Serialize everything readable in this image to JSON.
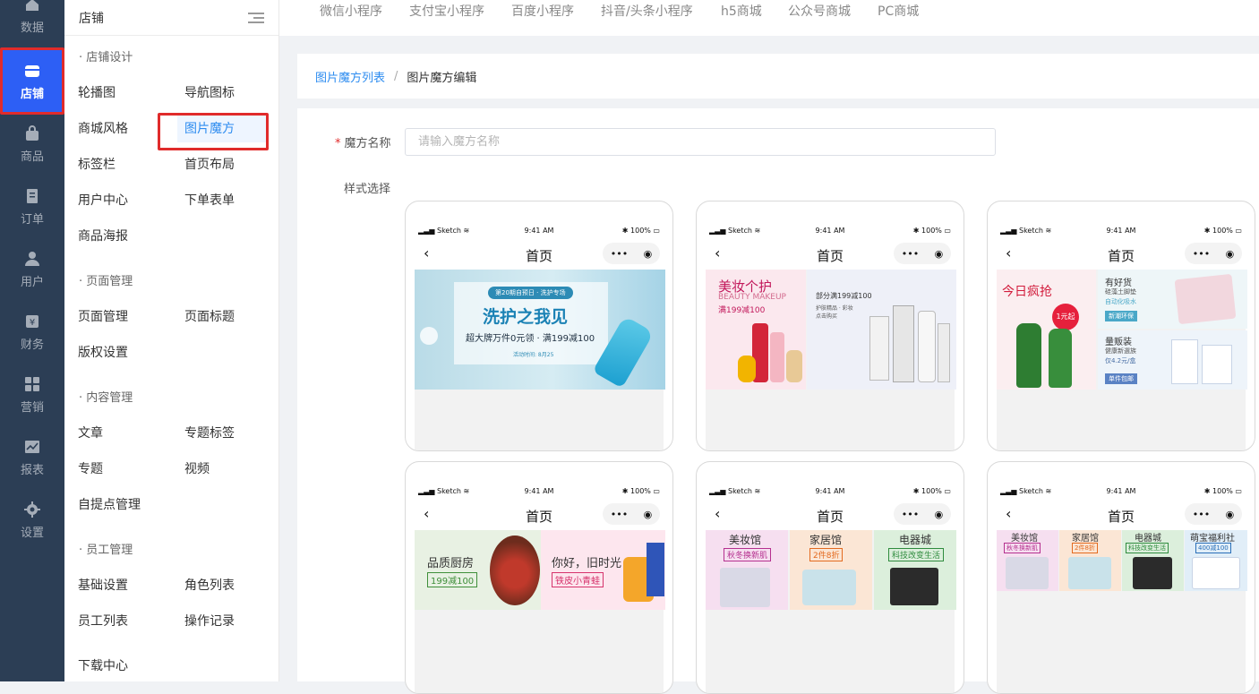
{
  "rail": [
    {
      "label": "数据",
      "icon": "home-icon"
    },
    {
      "label": "店铺",
      "icon": "store-icon",
      "active": true
    },
    {
      "label": "商品",
      "icon": "bag-icon"
    },
    {
      "label": "订单",
      "icon": "order-icon"
    },
    {
      "label": "用户",
      "icon": "user-icon"
    },
    {
      "label": "财务",
      "icon": "yen-icon"
    },
    {
      "label": "营销",
      "icon": "grid-icon"
    },
    {
      "label": "报表",
      "icon": "chart-icon"
    },
    {
      "label": "设置",
      "icon": "gear-icon"
    }
  ],
  "submenu": {
    "title": "店铺",
    "groups": {
      "design": "· 店铺设计",
      "page": "· 页面管理",
      "content": "· 内容管理",
      "staff": "· 员工管理"
    },
    "items": {
      "carousel": "轮播图",
      "nav_icon": "导航图标",
      "mall_style": "商城风格",
      "image_cube": "图片魔方",
      "tabbar": "标签栏",
      "home_layout": "首页布局",
      "user_center": "用户中心",
      "order_form": "下单表单",
      "poster": "商品海报",
      "page_manage": "页面管理",
      "page_title": "页面标题",
      "copyright": "版权设置",
      "article": "文章",
      "topic_tag": "专题标签",
      "topic": "专题",
      "video": "视频",
      "pickup": "自提点管理",
      "basic": "基础设置",
      "roles": "角色列表",
      "staff_list": "员工列表",
      "oplog": "操作记录",
      "download": "下载中心"
    }
  },
  "topbar": [
    "微信小程序",
    "支付宝小程序",
    "百度小程序",
    "抖音/头条小程序",
    "h5商城",
    "公众号商城",
    "PC商城"
  ],
  "breadcrumb": {
    "parent": "图片魔方列表",
    "sep": "/",
    "current": "图片魔方编辑"
  },
  "form": {
    "name_label": "魔方名称",
    "required_mark": "*",
    "name_placeholder": "请输入魔方名称",
    "name_value": "",
    "style_label": "样式选择"
  },
  "phone": {
    "carrier": "Sketch",
    "time": "9:41 AM",
    "battery": "100%",
    "title": "首页",
    "back": "‹",
    "more": "•••",
    "target": "◉"
  },
  "banners": {
    "wash_top": "第20期自预日 · 洗护专场",
    "wash_title": "洗护之我见",
    "wash_sub": "超大牌万件0元领 · 满199减100",
    "wash_time": "活动时间: 8月25",
    "makeup_title": "美妆个护",
    "makeup_en": "BEAUTY MAKEUP",
    "makeup_deal": "满199减100",
    "part_deal": "部分满199减100",
    "part_sub1": "护肤精品 · 彩妆",
    "part_sub2": "点击购买",
    "grab": "今日疯抢",
    "price_tag": "1元起",
    "goods": "有好货",
    "goods_sub": "硅藻土脚垫",
    "goods_sub2": "自动化吸水",
    "badge_eco": "新潮环保",
    "bulk": "量贩装",
    "bulk_sub": "健康新選族",
    "bulk_sub2": "仅4.2元/盒",
    "badge_ship": "单件包邮",
    "kitchen": "品质厨房",
    "kitchen_deal": "199减100",
    "nostalgia": "你好，旧时光",
    "nostalgia_deal": "铁皮小青蛙",
    "beauty_hall": "美妆馆",
    "beauty_hall_tag": "秋冬换新肌",
    "home_hall": "家居馆",
    "home_hall_tag": "2件8折",
    "elec_hall": "电器城",
    "elec_hall_tag": "科技改变生活",
    "baby_hall": "萌宝福利社",
    "baby_hall_tag": "400减100"
  }
}
